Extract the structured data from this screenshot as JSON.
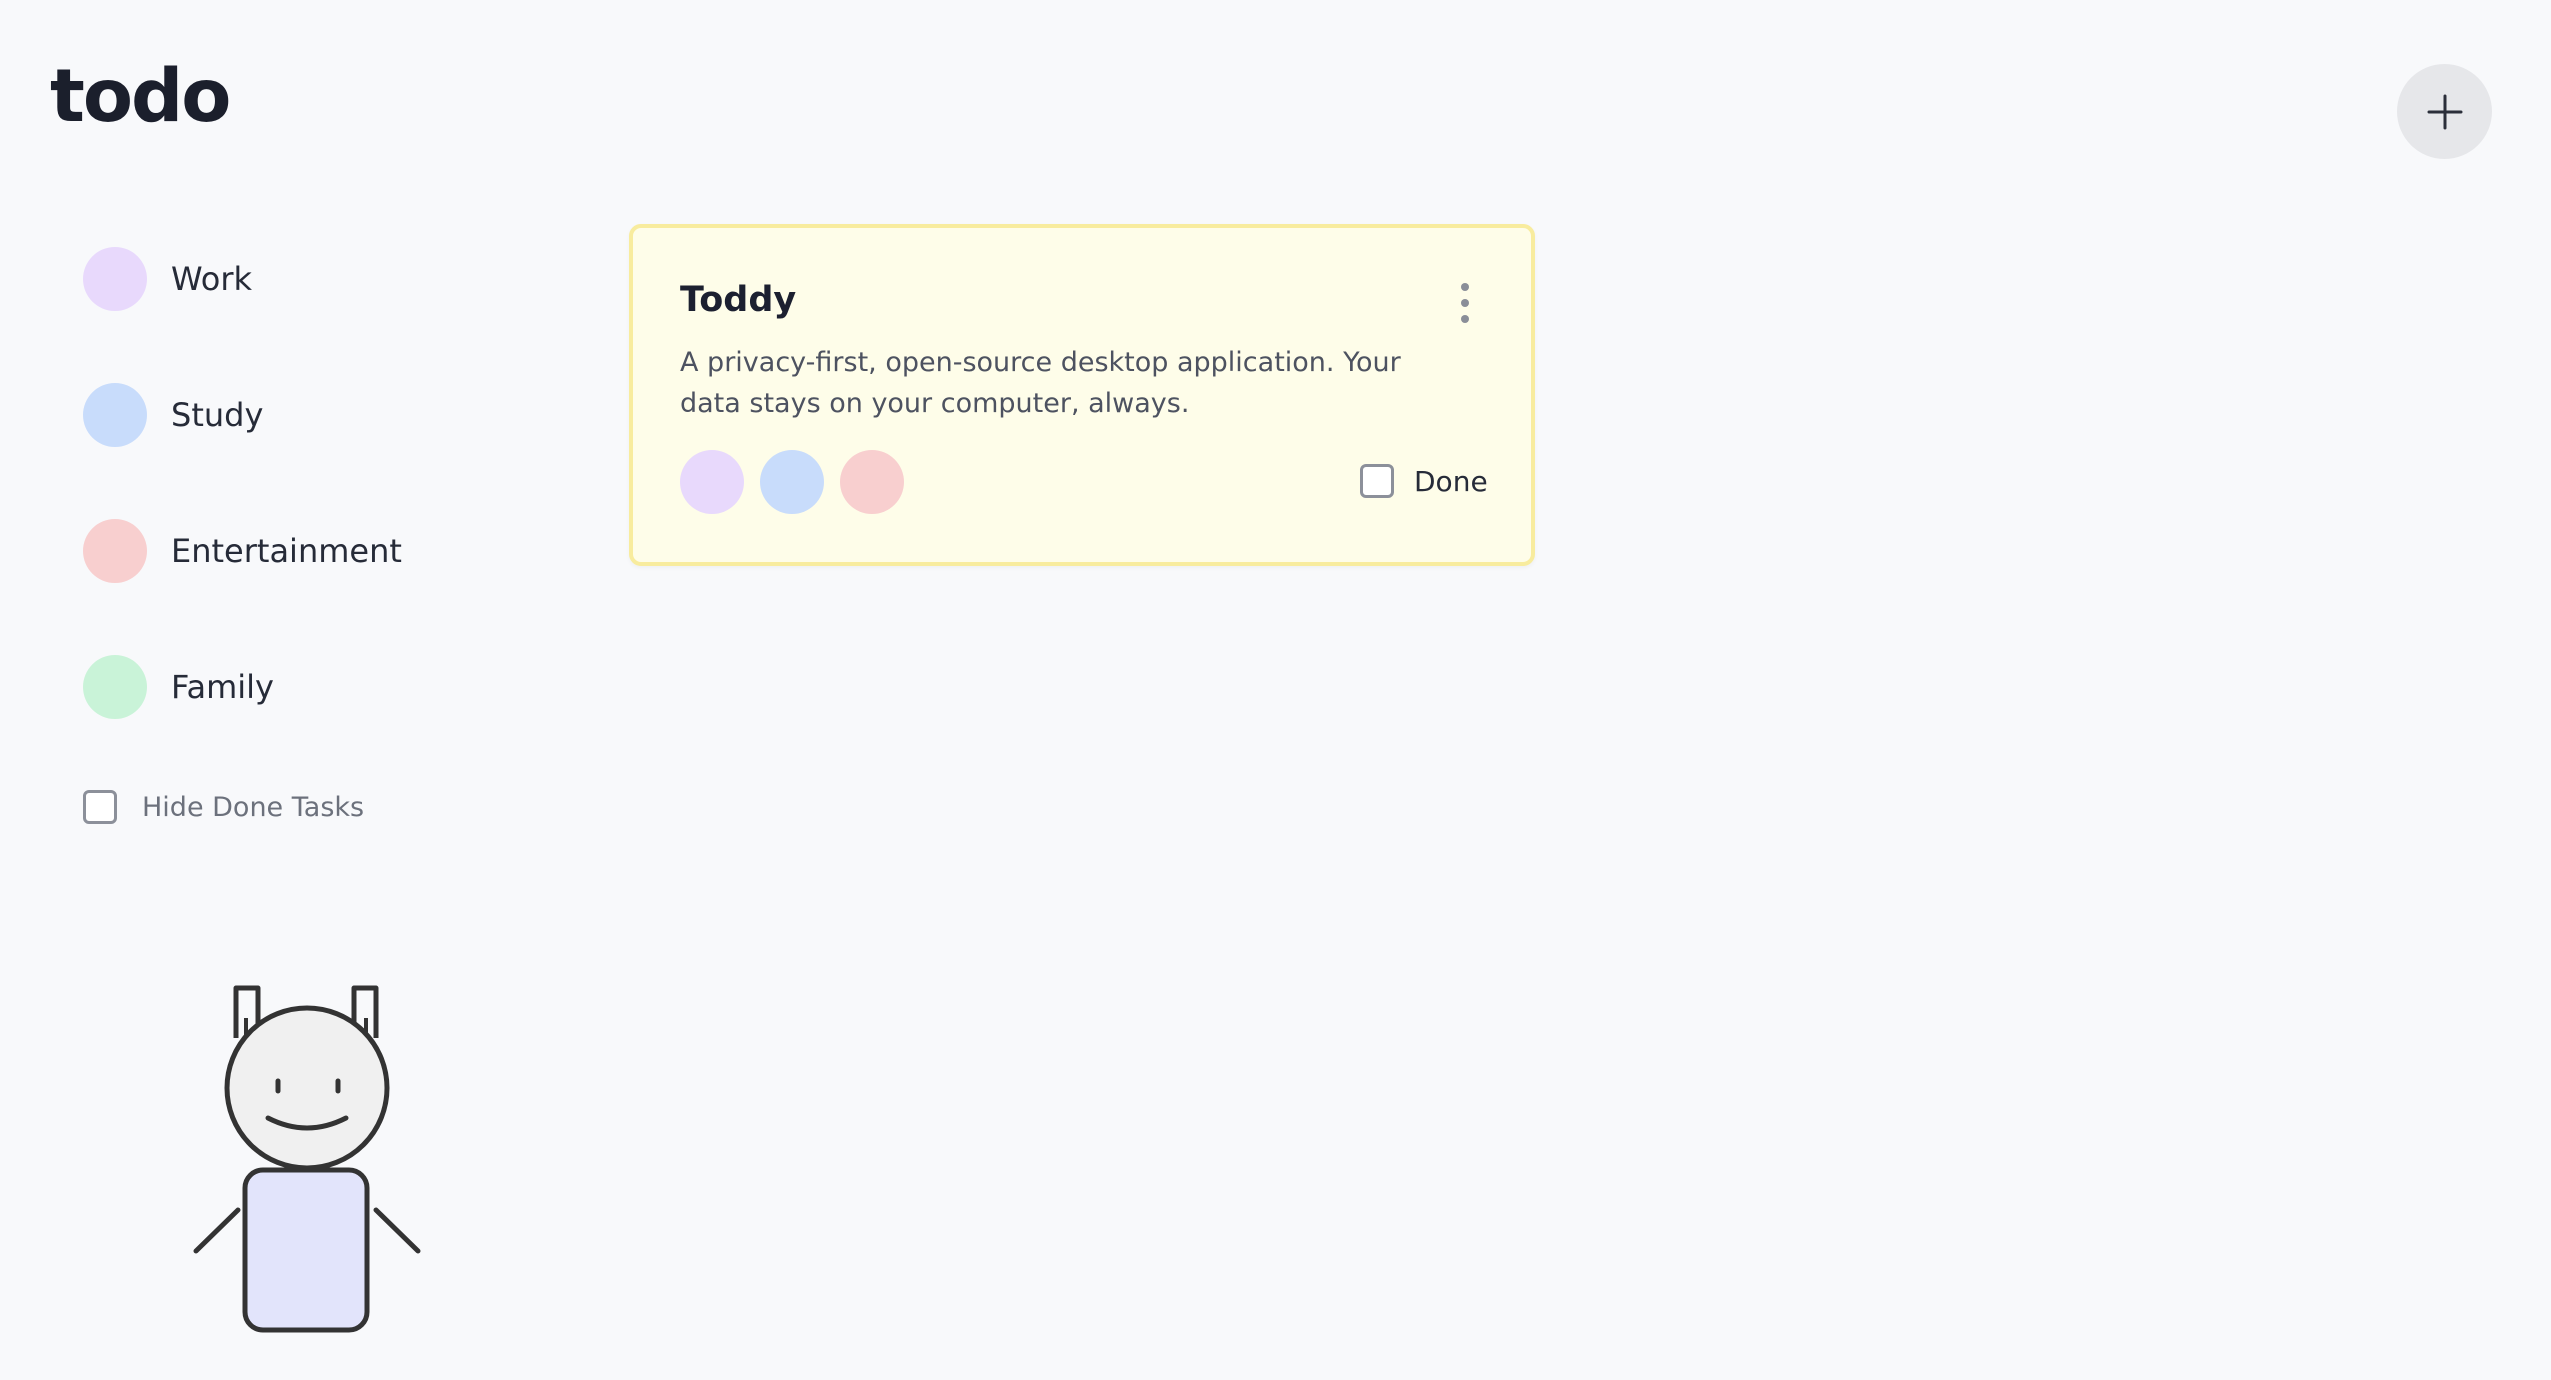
{
  "app": {
    "title": "todo"
  },
  "header": {
    "add_icon": "plus-icon"
  },
  "sidebar": {
    "categories": [
      {
        "label": "Work",
        "color": "#e8d9fc"
      },
      {
        "label": "Study",
        "color": "#c8dcfb"
      },
      {
        "label": "Entertainment",
        "color": "#f8cfcf"
      },
      {
        "label": "Family",
        "color": "#c9f3d8"
      }
    ],
    "hide_done_label": "Hide Done Tasks",
    "hide_done_checked": false
  },
  "tasks": [
    {
      "title": "Toddy",
      "description": "A privacy-first, open-source desktop application. Your data stays on your computer, always.",
      "tags": [
        "Work",
        "Study",
        "Entertainment"
      ],
      "tag_colors": [
        "#e8d9fc",
        "#c8dcfb",
        "#f8cfcf"
      ],
      "done_label": "Done",
      "done": false,
      "menu_icon": "more-vertical-icon",
      "card_color": "#fefde9",
      "card_border_color": "#f8ec9e"
    }
  ],
  "mascot": {
    "icon": "robot-mascot-icon",
    "body_color": "#e2e4fb"
  }
}
